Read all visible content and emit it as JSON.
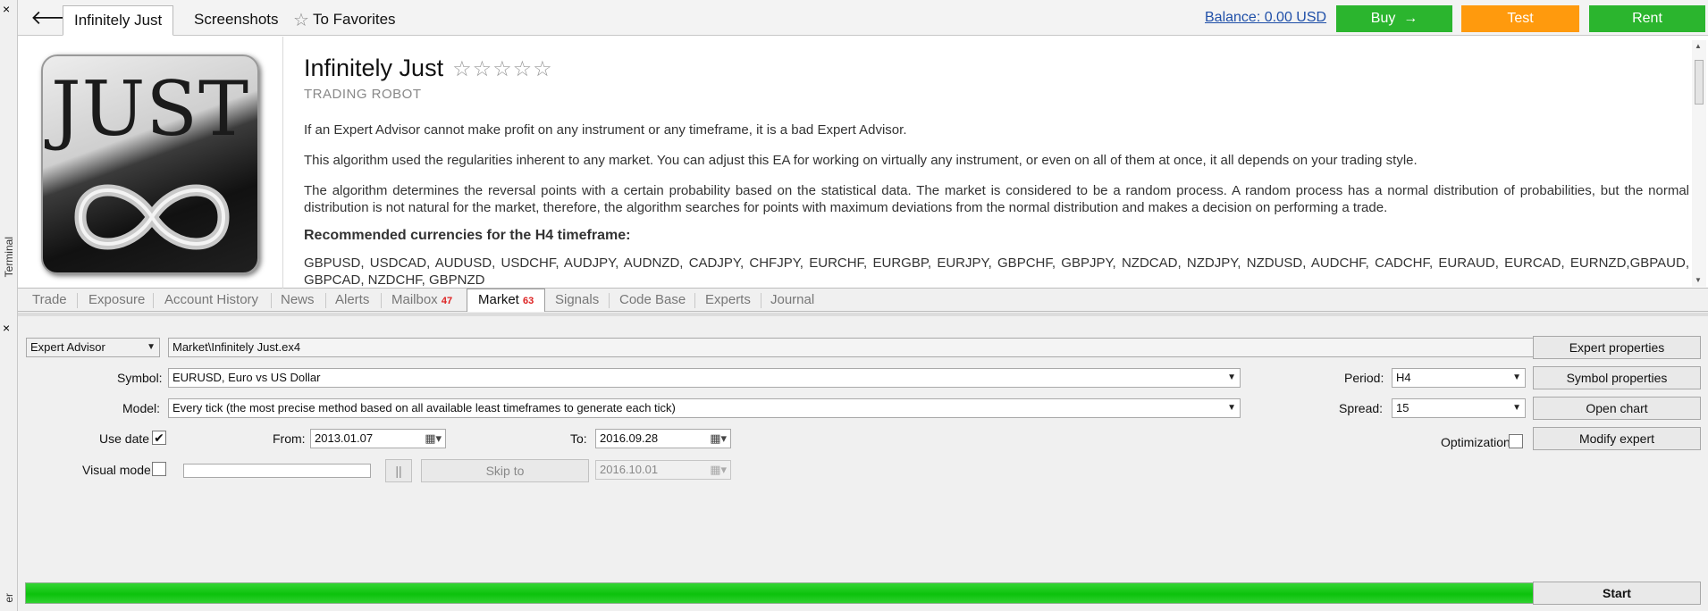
{
  "window": {
    "close_top": "×",
    "close_bottom": "×",
    "terminal_label": "Terminal",
    "tester_label": "er"
  },
  "top": {
    "back_icon": "arrow-left-icon",
    "tabs": [
      {
        "label": "Infinitely Just",
        "active": true
      },
      {
        "label": "Screenshots",
        "active": false
      },
      {
        "label": "To Favorites",
        "active": false
      }
    ],
    "balance": "Balance: 0.00 USD",
    "buy_label": "Buy",
    "buy_arrow": "→",
    "test_label": "Test",
    "rent_label": "Rent",
    "colors": {
      "buy": "#2bb52e",
      "test": "#ff9a0d",
      "rent": "#2bb52e",
      "balance_link": "#1f4fa8"
    }
  },
  "product": {
    "logo_text": "JUST",
    "title": "Infinitely Just",
    "stars": "☆☆☆☆☆",
    "subtitle": "TRADING ROBOT",
    "paragraphs": [
      "If an Expert Advisor cannot make profit on any instrument or any timeframe, it is a bad Expert Advisor.",
      "This algorithm used the regularities inherent to any market. You can adjust this EA for working on virtually any instrument, or even on all of them at once, it all depends on your trading style.",
      "The algorithm determines the reversal points with a certain probability based on the statistical data. The market is considered to be a random process. A random process has a normal distribution of probabilities, but the normal distribution is not natural for the market, therefore, the algorithm searches for points with maximum deviations from the normal distribution and makes a decision on performing a trade."
    ],
    "recommended_heading": "Recommended currencies for the H4 timeframe:",
    "currencies": "GBPUSD, USDCAD, AUDUSD, USDCHF, AUDJPY, AUDNZD, CADJPY, CHFJPY, EURCHF, EURGBP, EURJPY, GBPCHF, GBPJPY, NZDCAD, NZDJPY, NZDUSD, AUDCHF, CADCHF, EURAUD, EURCAD, EURNZD,GBPAUD, GBPCAD, NZDCHF, GBPNZD"
  },
  "terminal_tabs": [
    {
      "label": "Trade"
    },
    {
      "label": "Exposure"
    },
    {
      "label": "Account History"
    },
    {
      "label": "News"
    },
    {
      "label": "Alerts"
    },
    {
      "label": "Mailbox",
      "count": "47"
    },
    {
      "label": "Market",
      "count": "63",
      "active": true
    },
    {
      "label": "Signals"
    },
    {
      "label": "Code Base"
    },
    {
      "label": "Experts"
    },
    {
      "label": "Journal"
    }
  ],
  "tester": {
    "type": "Expert Advisor",
    "expert_path": "Market\\Infinitely Just.ex4",
    "symbol_label": "Symbol:",
    "symbol": "EURUSD, Euro vs US Dollar",
    "model_label": "Model:",
    "model": "Every tick (the most precise method based on all available least timeframes to generate each tick)",
    "use_date_label": "Use date",
    "use_date_checked": "✔",
    "from_label": "From:",
    "from": "2013.01.07",
    "to_label": "To:",
    "to": "2016.09.28",
    "visual_mode_label": "Visual mode",
    "pause_label": "||",
    "skip_to_label": "Skip to",
    "skip_to_date": "2016.10.01",
    "period_label": "Period:",
    "period": "H4",
    "spread_label": "Spread:",
    "spread": "15",
    "optimization_label": "Optimization",
    "buttons": {
      "expert_properties": "Expert properties",
      "symbol_properties": "Symbol properties",
      "open_chart": "Open chart",
      "modify_expert": "Modify expert",
      "start": "Start"
    },
    "progress_percent": 100,
    "progress_color": "#0cc20c"
  }
}
